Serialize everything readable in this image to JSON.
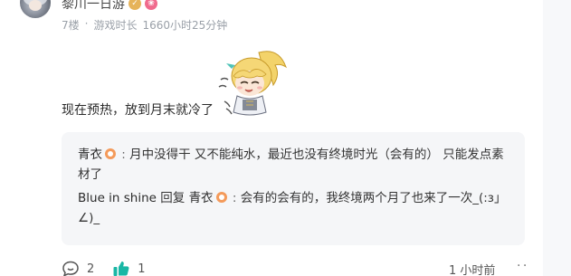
{
  "comment": {
    "username": "黎川一日游",
    "floor": "7楼",
    "separator": "·",
    "play_time_label": "游戏时长",
    "play_time_value": "1660小时25分钟",
    "text": "现在预热，放到月末就冷了"
  },
  "replies": [
    {
      "author": "青衣",
      "colon": " : ",
      "text": "月中没得干 又不能纯水，最近也没有终境时光（会有的） 只能发点素材了"
    },
    {
      "author": "Blue in shine",
      "reply_word": " 回复 ",
      "target": "青衣",
      "colon": " : ",
      "text": "会有的会有的，我终境两个月了也来了一次_(:з」∠)_"
    }
  ],
  "actions": {
    "comment_count": "2",
    "like_count": "1",
    "time_ago": "1 小时前",
    "more": "· ·"
  },
  "colors": {
    "like_icon": "#19b7a5",
    "reply_bg": "#f5f6f8",
    "meta_text": "#9aa0a8"
  }
}
